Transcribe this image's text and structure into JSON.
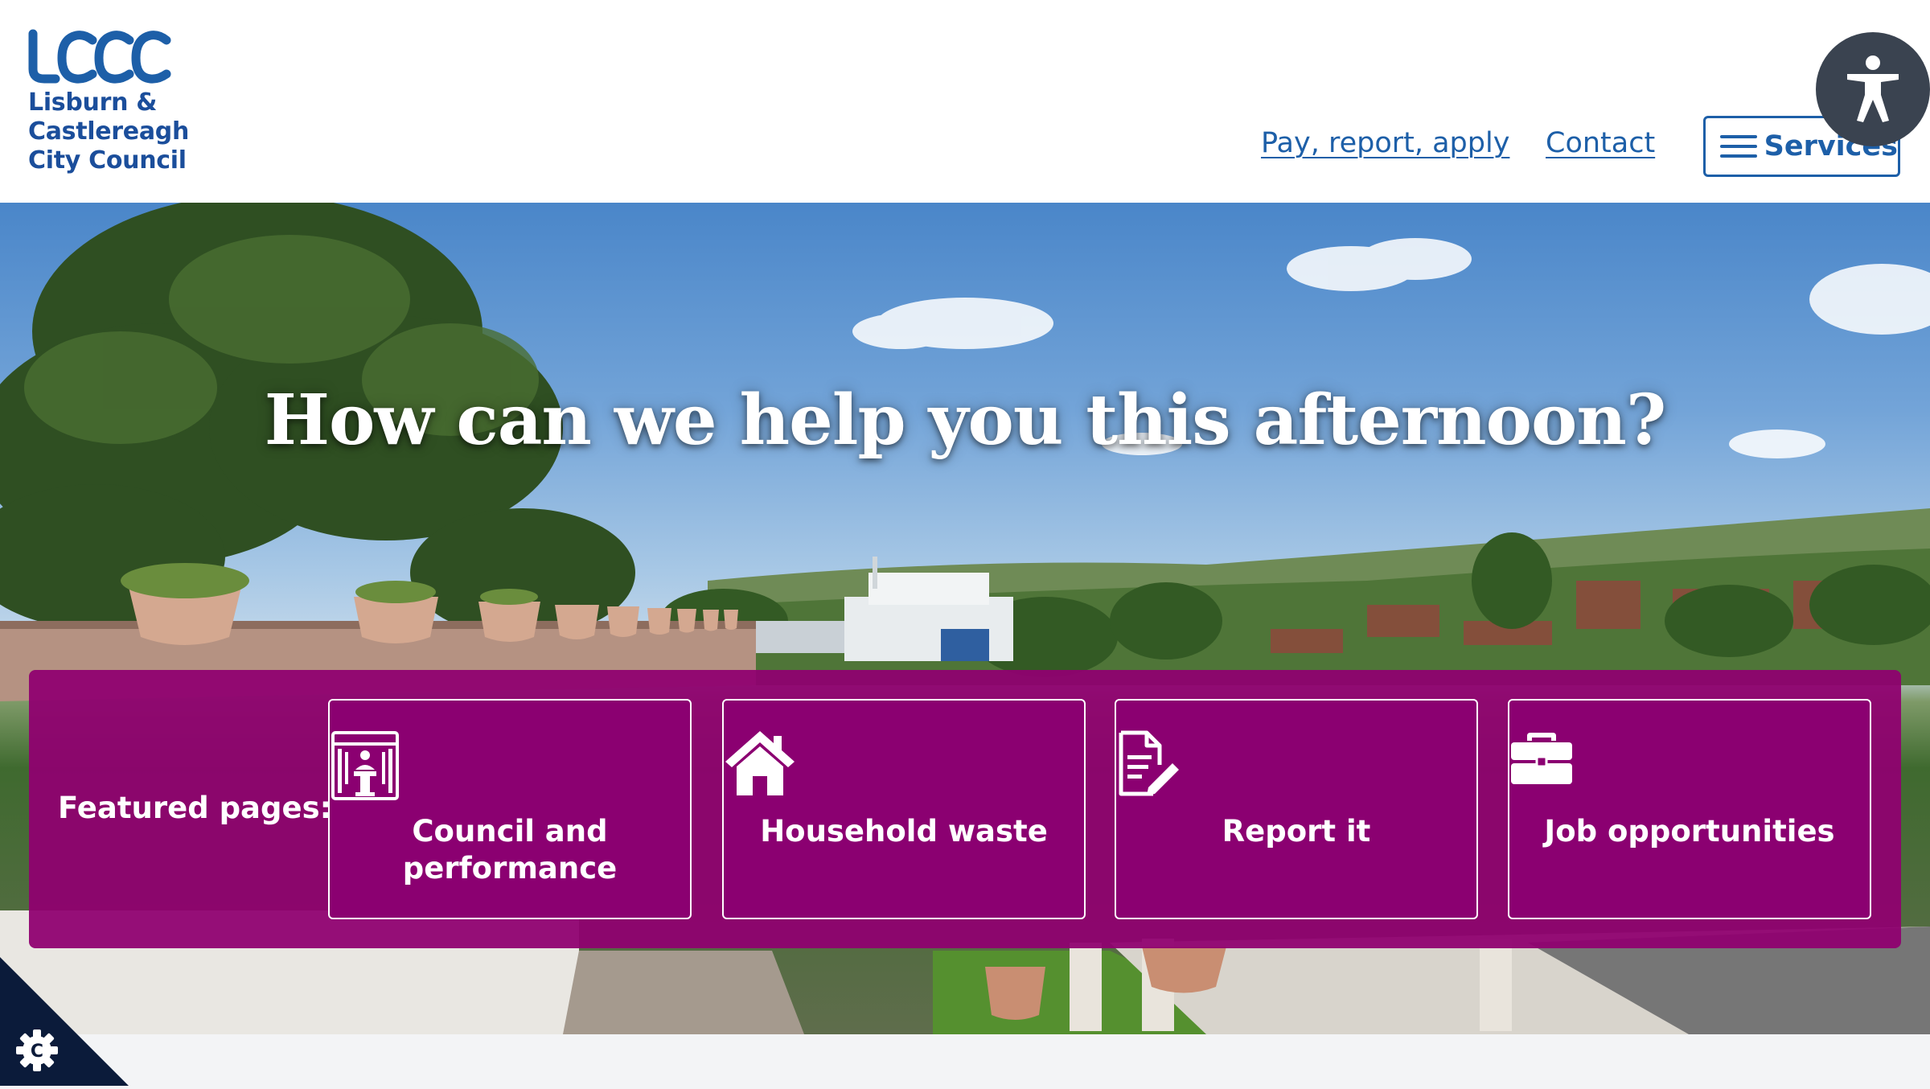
{
  "header": {
    "logo": {
      "mark_text": "LCCC",
      "lines": [
        "Lisburn &",
        "Castlereagh",
        "City Council"
      ],
      "color": "#1b4e9b"
    },
    "nav": {
      "pay_label": "Pay, report, apply",
      "contact_label": "Contact"
    },
    "services_button": {
      "label": "Services",
      "icon": "hamburger-menu-icon"
    },
    "accessibility_button": {
      "icon": "accessibility-person-icon"
    }
  },
  "hero": {
    "heading": "How can we help you this afternoon?"
  },
  "featured": {
    "label": "Featured pages:",
    "background": "#8f0070",
    "cards": [
      {
        "label": "Council and performance",
        "icon": "council-chamber-icon"
      },
      {
        "label": "Household waste",
        "icon": "house-icon"
      },
      {
        "label": "Report it",
        "icon": "document-edit-icon"
      },
      {
        "label": "Job opportunities",
        "icon": "briefcase-icon"
      }
    ]
  },
  "cookie_button": {
    "icon": "cookie-settings-gear-icon"
  },
  "colors": {
    "brand_blue": "#1d5fa8",
    "featured_magenta": "#8f0070",
    "accessibility_bg": "#3a4350"
  }
}
